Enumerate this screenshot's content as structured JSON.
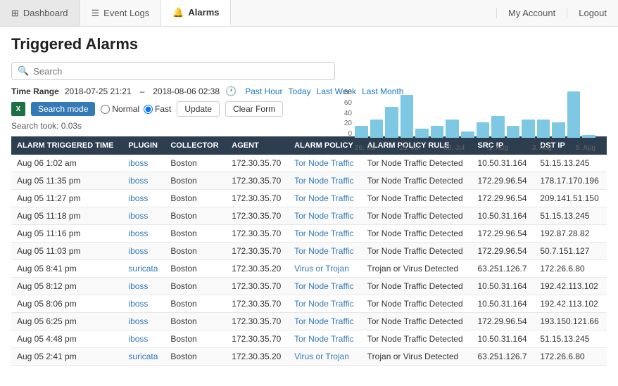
{
  "nav": {
    "items": [
      {
        "id": "dashboard",
        "label": "Dashboard",
        "icon": "grid-icon",
        "active": false
      },
      {
        "id": "event-logs",
        "label": "Event Logs",
        "icon": "list-icon",
        "active": false
      },
      {
        "id": "alarms",
        "label": "Alarms",
        "icon": "bell-icon",
        "active": true
      }
    ],
    "right_items": [
      {
        "id": "my-account",
        "label": "My Account"
      },
      {
        "id": "logout",
        "label": "Logout"
      }
    ]
  },
  "page": {
    "title": "Triggered Alarms"
  },
  "search": {
    "placeholder": "Search",
    "value": ""
  },
  "time_range": {
    "label": "Time Range",
    "start": "2018-07-25 21:21",
    "end": "2018-08-06 02:38",
    "links": [
      {
        "label": "Past Hour"
      },
      {
        "label": "Today"
      },
      {
        "label": "Last Week"
      },
      {
        "label": "Last Month"
      }
    ]
  },
  "mode_row": {
    "excel_label": "X",
    "search_mode_label": "Search mode",
    "normal_label": "Normal",
    "fast_label": "Fast",
    "update_label": "Update",
    "clear_label": "Clear Form"
  },
  "search_took": "Search took: 0.03s",
  "chart": {
    "y_labels": [
      "80",
      "60",
      "40",
      "20",
      "0"
    ],
    "bars": [
      20,
      30,
      50,
      70,
      15,
      20,
      30,
      10,
      25,
      35,
      20,
      30,
      30,
      25,
      75,
      5
    ],
    "x_labels": [
      "26. Jul",
      "28. Jul",
      "30. Jul",
      "1. Aug",
      "3. Aug",
      "5. Aug"
    ]
  },
  "table": {
    "headers": [
      "ALARM TRIGGERED TIME",
      "PLUGIN",
      "COLLECTOR",
      "AGENT",
      "ALARM POLICY",
      "ALARM POLICY RULE",
      "SRC IP",
      "DST IP"
    ],
    "rows": [
      [
        "Aug 06 1:02 am",
        "iboss",
        "Boston",
        "172.30.35.70",
        "Tor Node Traffic",
        "Tor Node Traffic Detected",
        "10.50.31.164",
        "51.15.13.245"
      ],
      [
        "Aug 05 11:35 pm",
        "iboss",
        "Boston",
        "172.30.35.70",
        "Tor Node Traffic",
        "Tor Node Traffic Detected",
        "172.29.96.54",
        "178.17.170.196"
      ],
      [
        "Aug 05 11:27 pm",
        "iboss",
        "Boston",
        "172.30.35.70",
        "Tor Node Traffic",
        "Tor Node Traffic Detected",
        "172.29.96.54",
        "209.141.51.150"
      ],
      [
        "Aug 05 11:18 pm",
        "iboss",
        "Boston",
        "172.30.35.70",
        "Tor Node Traffic",
        "Tor Node Traffic Detected",
        "10.50.31.164",
        "51.15.13.245"
      ],
      [
        "Aug 05 11:16 pm",
        "iboss",
        "Boston",
        "172.30.35.70",
        "Tor Node Traffic",
        "Tor Node Traffic Detected",
        "172.29.96.54",
        "192.87.28.82"
      ],
      [
        "Aug 05 11:03 pm",
        "iboss",
        "Boston",
        "172.30.35.70",
        "Tor Node Traffic",
        "Tor Node Traffic Detected",
        "172.29.96.54",
        "50.7.151.127"
      ],
      [
        "Aug 05 8:41 pm",
        "suricata",
        "Boston",
        "172.30.35.20",
        "Virus or Trojan",
        "Trojan or Virus Detected",
        "63.251.126.7",
        "172.26.6.80"
      ],
      [
        "Aug 05 8:12 pm",
        "iboss",
        "Boston",
        "172.30.35.70",
        "Tor Node Traffic",
        "Tor Node Traffic Detected",
        "10.50.31.164",
        "192.42.113.102"
      ],
      [
        "Aug 05 8:06 pm",
        "iboss",
        "Boston",
        "172.30.35.70",
        "Tor Node Traffic",
        "Tor Node Traffic Detected",
        "10.50.31.164",
        "192.42.113.102"
      ],
      [
        "Aug 05 6:25 pm",
        "iboss",
        "Boston",
        "172.30.35.70",
        "Tor Node Traffic",
        "Tor Node Traffic Detected",
        "172.29.96.54",
        "193.150.121.66"
      ],
      [
        "Aug 05 4:48 pm",
        "iboss",
        "Boston",
        "172.30.35.70",
        "Tor Node Traffic",
        "Tor Node Traffic Detected",
        "10.50.31.164",
        "51.15.13.245"
      ],
      [
        "Aug 05 2:41 pm",
        "suricata",
        "Boston",
        "172.30.35.20",
        "Virus or Trojan",
        "Trojan or Virus Detected",
        "63.251.126.7",
        "172.26.6.80"
      ]
    ]
  }
}
